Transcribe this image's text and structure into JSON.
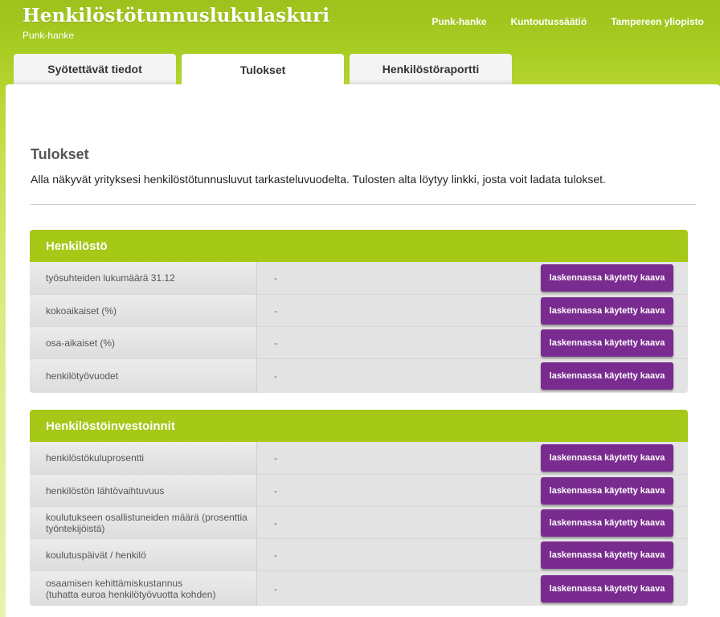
{
  "app": {
    "title": "Henkilöstötunnuslukulaskuri",
    "subtitle": "Punk-hanke"
  },
  "toplinks": [
    "Punk-hanke",
    "Kuntoutussäätiö",
    "Tampereen yliopisto"
  ],
  "tabs": [
    {
      "label": "Syötettävät tiedot",
      "active": false
    },
    {
      "label": "Tulokset",
      "active": true
    },
    {
      "label": "Henkilöstöraportti",
      "active": false
    }
  ],
  "main": {
    "title": "Tulokset",
    "intro": "Alla näkyvät yrityksesi henkilöstötunnusluvut tarkasteluvuodelta. Tulosten alta löytyy linkki, josta voit ladata tulokset."
  },
  "formula_button_label": "laskennassa käytetty kaava",
  "sections": [
    {
      "title": "Henkilöstö",
      "rows": [
        {
          "label": "työsuhteiden lukumäärä 31.12",
          "value": "-"
        },
        {
          "label": "kokoaikaiset (%)",
          "value": "-"
        },
        {
          "label": "osa-aikaiset (%)",
          "value": "-"
        },
        {
          "label": "henkilötyövuodet",
          "value": "-"
        }
      ]
    },
    {
      "title": "Henkilöstöinvestoinnit",
      "rows": [
        {
          "label": "henkilöstökuluprosentti",
          "value": "-"
        },
        {
          "label": "henkilöstön lähtövaihtuvuus",
          "value": "-"
        },
        {
          "label": "koulutukseen osallistuneiden määrä (prosenttia työntekijöistä)",
          "value": "-"
        },
        {
          "label": "koulutuspäivät / henkilö",
          "value": "-"
        },
        {
          "label": "osaamisen kehittämiskustannus\n(tuhatta euroa henkilötyövuotta kohden)",
          "value": "-"
        }
      ]
    }
  ],
  "colors": {
    "brand_green": "#a6c817",
    "button_purple": "#7a2b8f"
  }
}
